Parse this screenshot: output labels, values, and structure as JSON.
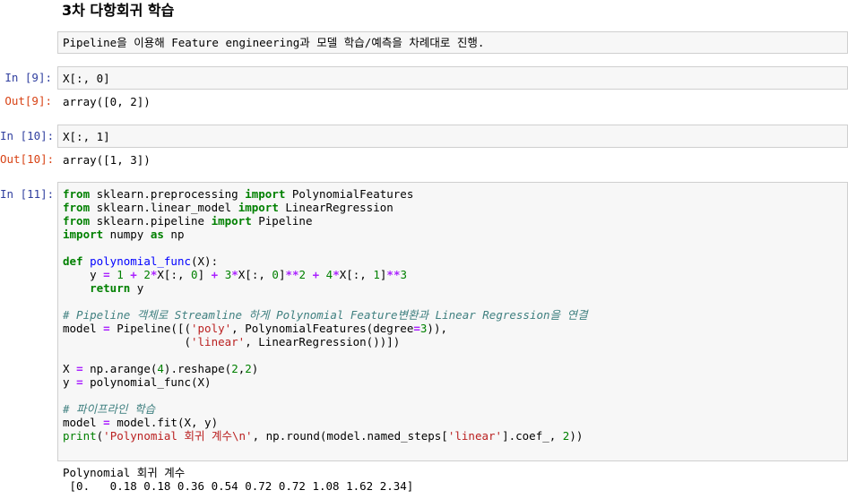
{
  "heading": "3차 다항회귀 학습",
  "markdown": "Pipeline을 이용해 Feature engineering과 모델 학습/예측을 차례대로 진행.",
  "cells": [
    {
      "in_prompt": "In [9]:",
      "code": "X[:, 0]",
      "out_prompt": "Out[9]:",
      "output": "array([0, 2])"
    },
    {
      "in_prompt": "In [10]:",
      "code": "X[:, 1]",
      "out_prompt": "Out[10]:",
      "output": "array([1, 3])"
    },
    {
      "in_prompt": "In [11]:",
      "code_lines": [
        "from sklearn.preprocessing import PolynomialFeatures",
        "from sklearn.linear_model import LinearRegression",
        "from sklearn.pipeline import Pipeline",
        "import numpy as np",
        "",
        "def polynomial_func(X):",
        "    y = 1 + 2*X[:, 0] + 3*X[:, 0]**2 + 4*X[:, 1]**3",
        "    return y",
        "",
        "# Pipeline 객체로 Streamline 하게 Polynomial Feature변환과 Linear Regression을 연결",
        "model = Pipeline([('poly', PolynomialFeatures(degree=3)),",
        "                  ('linear', LinearRegression())])",
        "",
        "X = np.arange(4).reshape(2,2)",
        "y = polynomial_func(X)",
        "",
        "# 파이프라인 학습",
        "model = model.fit(X, y)",
        "print('Polynomial 회귀 계수\\n', np.round(model.named_steps['linear'].coef_, 2))"
      ],
      "output_lines": [
        "Polynomial 회귀 계수",
        " [0.   0.18 0.18 0.36 0.54 0.72 0.72 1.08 1.62 2.34]"
      ]
    }
  ]
}
